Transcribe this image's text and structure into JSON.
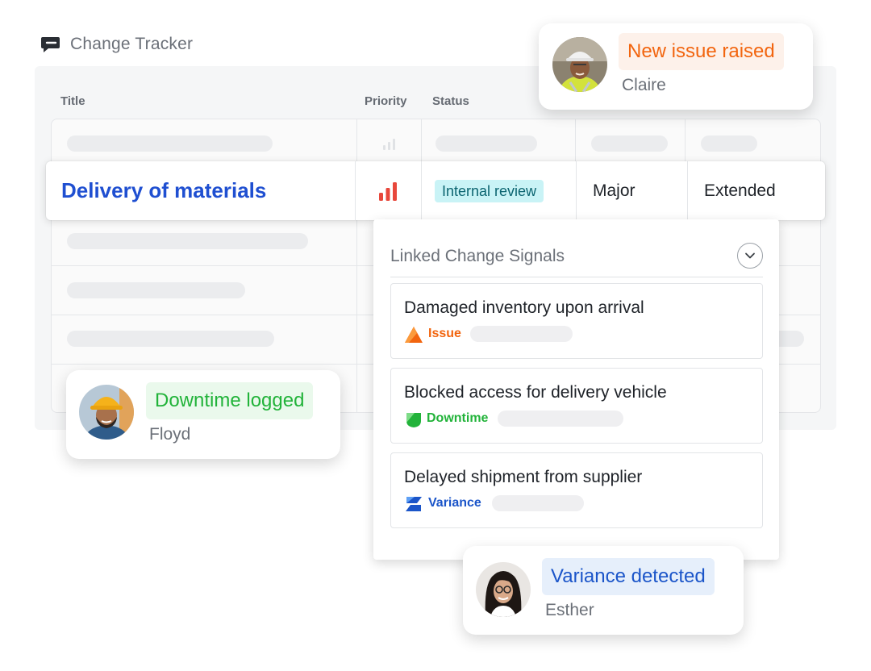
{
  "app": {
    "title": "Change Tracker"
  },
  "table": {
    "columns": {
      "title": "Title",
      "priority": "Priority",
      "status": "Status"
    },
    "row": {
      "title": "Delivery of materials",
      "status": "Internal review",
      "impact": "Major",
      "schedule": "Extended"
    }
  },
  "linked": {
    "heading": "Linked Change Signals",
    "items": [
      {
        "title": "Damaged inventory upon arrival",
        "type": "Issue"
      },
      {
        "title": "Blocked access for delivery vehicle",
        "type": "Downtime"
      },
      {
        "title": "Delayed shipment from supplier",
        "type": "Variance"
      }
    ]
  },
  "notifications": [
    {
      "badge": "New issue raised",
      "name": "Claire"
    },
    {
      "badge": "Downtime logged",
      "name": "Floyd"
    },
    {
      "badge": "Variance detected",
      "name": "Esther"
    }
  ],
  "colors": {
    "title_blue": "#1f4fd1",
    "issue_orange": "#f2650f",
    "downtime_green": "#22b33a",
    "variance_blue": "#1b55c9",
    "priority_red": "#e8473b",
    "status_bg": "#c9f3f6"
  },
  "icons": [
    "tracker-logo-icon",
    "priority-high-icon",
    "chevron-down-icon",
    "issue-icon",
    "downtime-icon",
    "variance-icon"
  ]
}
